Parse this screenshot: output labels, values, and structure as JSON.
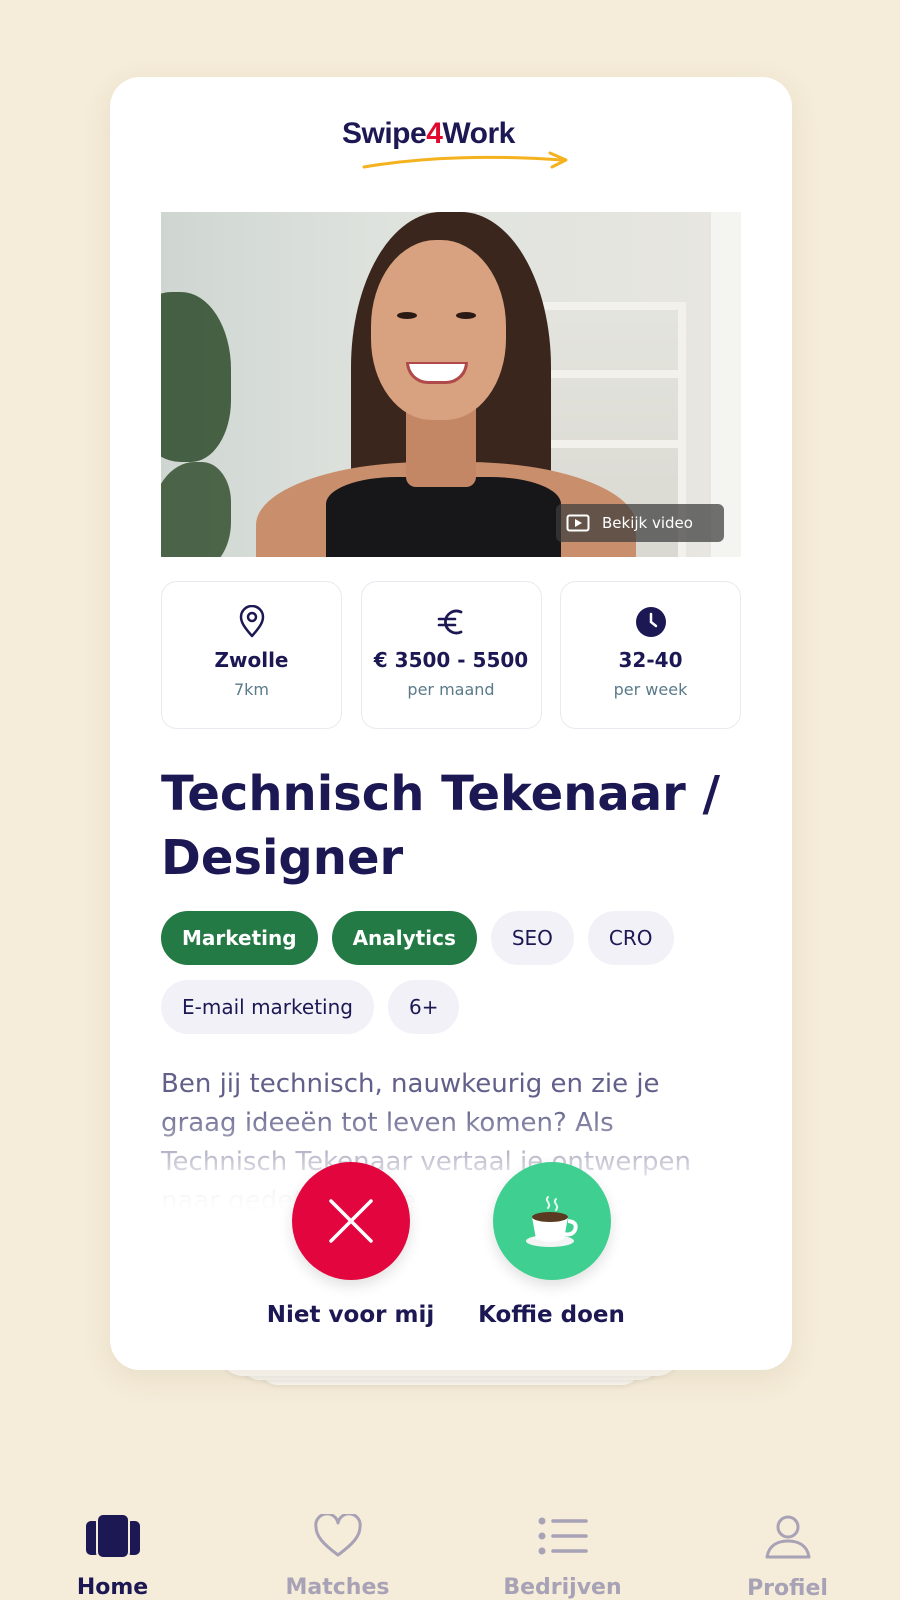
{
  "brand": {
    "name_part1": "Swipe",
    "name_part2": "4",
    "name_part3": "Work",
    "primary_color": "#1c1853",
    "accent_red": "#e0082f",
    "accent_yellow": "#f5b21f"
  },
  "job": {
    "video_label": "Bekijk video",
    "info": [
      {
        "icon": "location-pin-icon",
        "main": "Zwolle",
        "sub": "7km"
      },
      {
        "icon": "euro-icon",
        "main": "€ 3500 - 5500",
        "sub": "per maand"
      },
      {
        "icon": "clock-icon",
        "main": "32-40",
        "sub": "per week"
      }
    ],
    "title": "Technisch Tekenaar / Designer",
    "tags": [
      {
        "label": "Marketing",
        "active": true
      },
      {
        "label": "Analytics",
        "active": true
      },
      {
        "label": "SEO",
        "active": false
      },
      {
        "label": "CRO",
        "active": false
      },
      {
        "label": "E-mail marketing",
        "active": false
      },
      {
        "label": "6+",
        "active": false
      }
    ],
    "description": "Ben jij technisch, nauwkeurig en zie je graag ideeën tot leven komen? Als Technisch Tekenaar vertaal je ontwerpen naar gedetailleerde"
  },
  "actions": {
    "reject_label": "Niet voor mij",
    "accept_label": "Koffie doen",
    "reject_color": "#e3063e",
    "accept_color": "#3fcf90"
  },
  "nav": {
    "items": [
      {
        "label": "Home",
        "icon": "cards-icon",
        "active": true
      },
      {
        "label": "Matches",
        "icon": "heart-icon",
        "active": false
      },
      {
        "label": "Bedrijven",
        "icon": "list-icon",
        "active": false
      },
      {
        "label": "Profiel",
        "icon": "user-icon",
        "active": false
      }
    ]
  }
}
